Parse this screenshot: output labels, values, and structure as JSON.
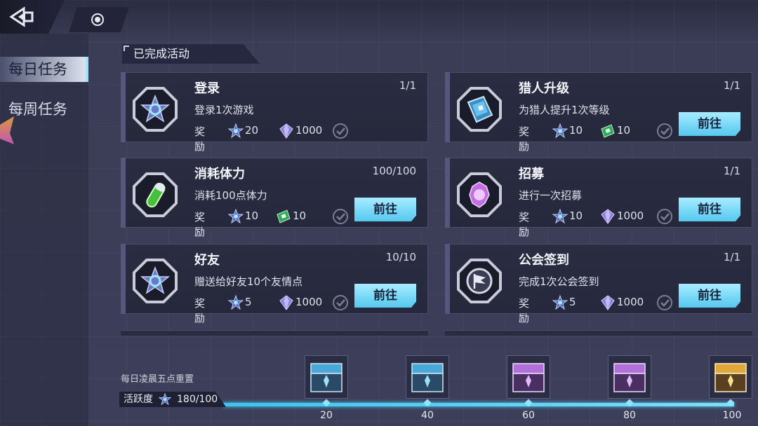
{
  "nav": {
    "back_icon": "back-arrow-icon",
    "home_icon": "home-dot-icon"
  },
  "sidebar": {
    "tabs": [
      {
        "label": "每日任务",
        "active": true
      },
      {
        "label": "每周任务",
        "active": false
      }
    ]
  },
  "section": {
    "title": "已完成活动"
  },
  "reward_label": "奖励",
  "go_label": "前往",
  "tasks": [
    {
      "title": "登录",
      "progress": "1/1",
      "desc": "登录1次游戏",
      "icon": "star-badge-icon",
      "rewards": [
        {
          "icon": "activity-star-icon",
          "value": "20"
        },
        {
          "icon": "diamond-icon",
          "value": "1000"
        }
      ],
      "has_go": false
    },
    {
      "title": "猎人升级",
      "progress": "1/1",
      "desc": "为猎人提升1次等级",
      "icon": "book-icon",
      "rewards": [
        {
          "icon": "activity-star-icon",
          "value": "10"
        },
        {
          "icon": "green-ticket-icon",
          "value": "10"
        }
      ],
      "has_go": true
    },
    {
      "title": "消耗体力",
      "progress": "100/100",
      "desc": "消耗100点体力",
      "icon": "stamina-vial-icon",
      "rewards": [
        {
          "icon": "activity-star-icon",
          "value": "10"
        },
        {
          "icon": "green-ticket-icon",
          "value": "10"
        }
      ],
      "has_go": true
    },
    {
      "title": "招募",
      "progress": "1/1",
      "desc": "进行一次招募",
      "icon": "recruit-crystal-icon",
      "rewards": [
        {
          "icon": "activity-star-icon",
          "value": "10"
        },
        {
          "icon": "diamond-icon",
          "value": "1000"
        }
      ],
      "has_go": true
    },
    {
      "title": "好友",
      "progress": "10/10",
      "desc": "赠送给好友10个友情点",
      "icon": "star-badge-icon",
      "rewards": [
        {
          "icon": "activity-star-icon",
          "value": "5"
        },
        {
          "icon": "diamond-icon",
          "value": "1000"
        }
      ],
      "has_go": true
    },
    {
      "title": "公会签到",
      "progress": "1/1",
      "desc": "完成1次公会签到",
      "icon": "guild-flag-icon",
      "rewards": [
        {
          "icon": "activity-star-icon",
          "value": "5"
        },
        {
          "icon": "diamond-icon",
          "value": "1000"
        }
      ],
      "has_go": true
    }
  ],
  "footer": {
    "reset_note": "每日凌晨五点重置",
    "activity_label": "活跃度",
    "activity_value": "180/100",
    "milestones": [
      {
        "value": "20",
        "chest": "blue"
      },
      {
        "value": "40",
        "chest": "blue"
      },
      {
        "value": "60",
        "chest": "purple"
      },
      {
        "value": "80",
        "chest": "purple"
      },
      {
        "value": "100",
        "chest": "gold"
      }
    ]
  },
  "colors": {
    "accent": "#55c8ef",
    "chest_blue": "#4aa8d8",
    "chest_purple": "#b070d8",
    "chest_gold": "#e0a838"
  }
}
